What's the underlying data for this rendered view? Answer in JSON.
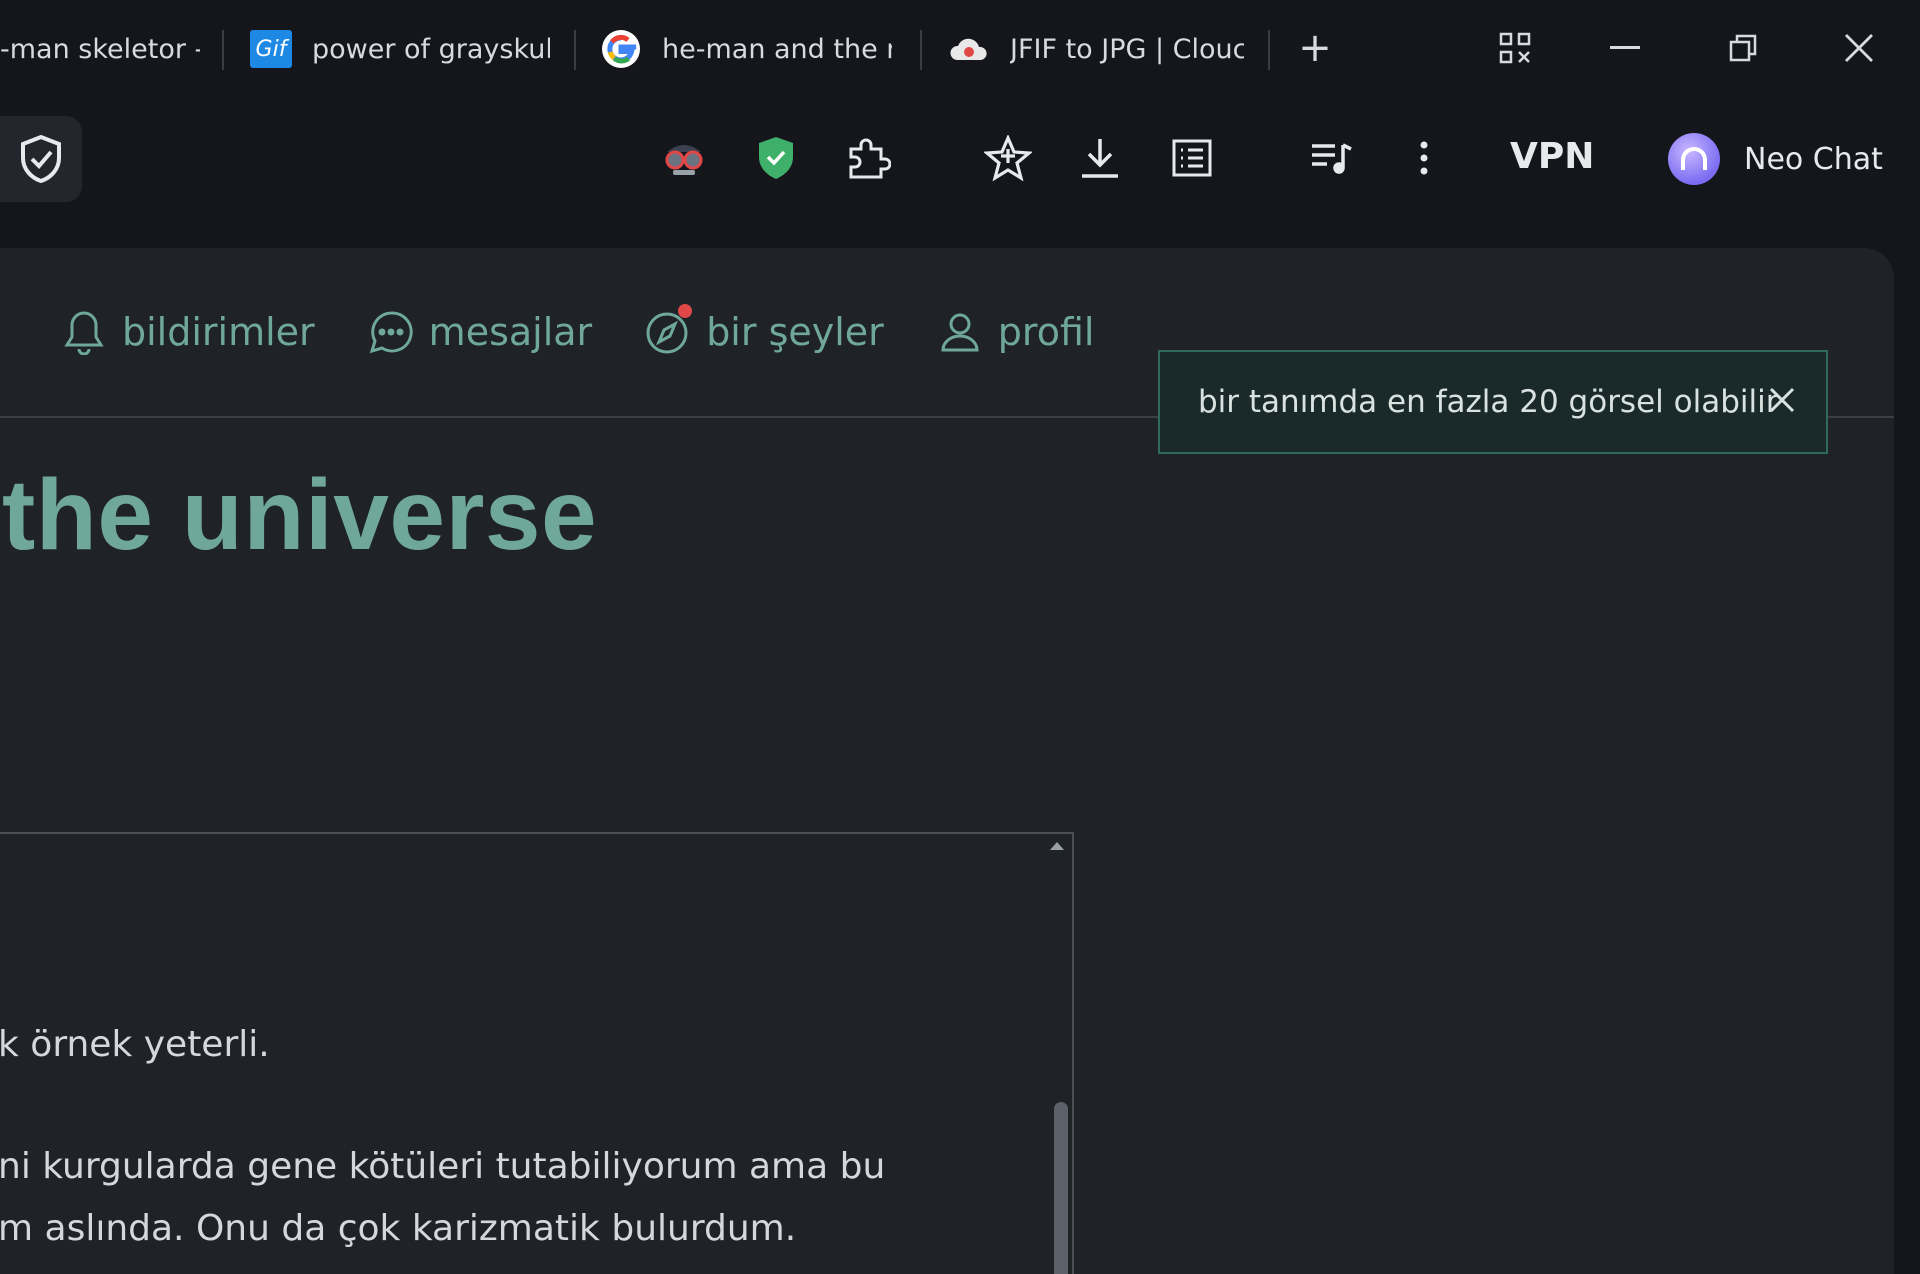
{
  "tabs": [
    {
      "title": "-man skeletor - (",
      "favicon": "skeleton-favicon"
    },
    {
      "title": "power of grayskul",
      "favicon": "gif-favicon",
      "favicon_text": "Gif"
    },
    {
      "title": "he-man and the m",
      "favicon": "google-favicon"
    },
    {
      "title": "JFIF to JPG | Clouc",
      "favicon": "cloudconvert-favicon"
    }
  ],
  "new_tab_symbol": "+",
  "toolbar": {
    "vpn_label": "VPN",
    "profile_name": "Neo Chat"
  },
  "nav": {
    "items": [
      {
        "label": "bildirimler",
        "icon": "bell-icon"
      },
      {
        "label": "mesajlar",
        "icon": "chat-bubble-icon"
      },
      {
        "label": "bir şeyler",
        "icon": "compass-icon",
        "badge": true
      },
      {
        "label": "profil",
        "icon": "user-icon"
      }
    ]
  },
  "toast": {
    "message": "bir tanımda en fazla 20 görsel olabilir"
  },
  "page": {
    "heading": "the universe"
  },
  "editor": {
    "lines": [
      "k örnek yeterli.",
      "ni kurgularda gene kötüleri tutabiliyorum ama bu",
      "m aslında. Onu da çok karizmatik bulurdum."
    ]
  },
  "colors": {
    "accent": "#6fa89a",
    "background": "#14161c",
    "panel": "#1f2227",
    "toast_border": "#2e6a5f",
    "badge": "#e04848"
  }
}
